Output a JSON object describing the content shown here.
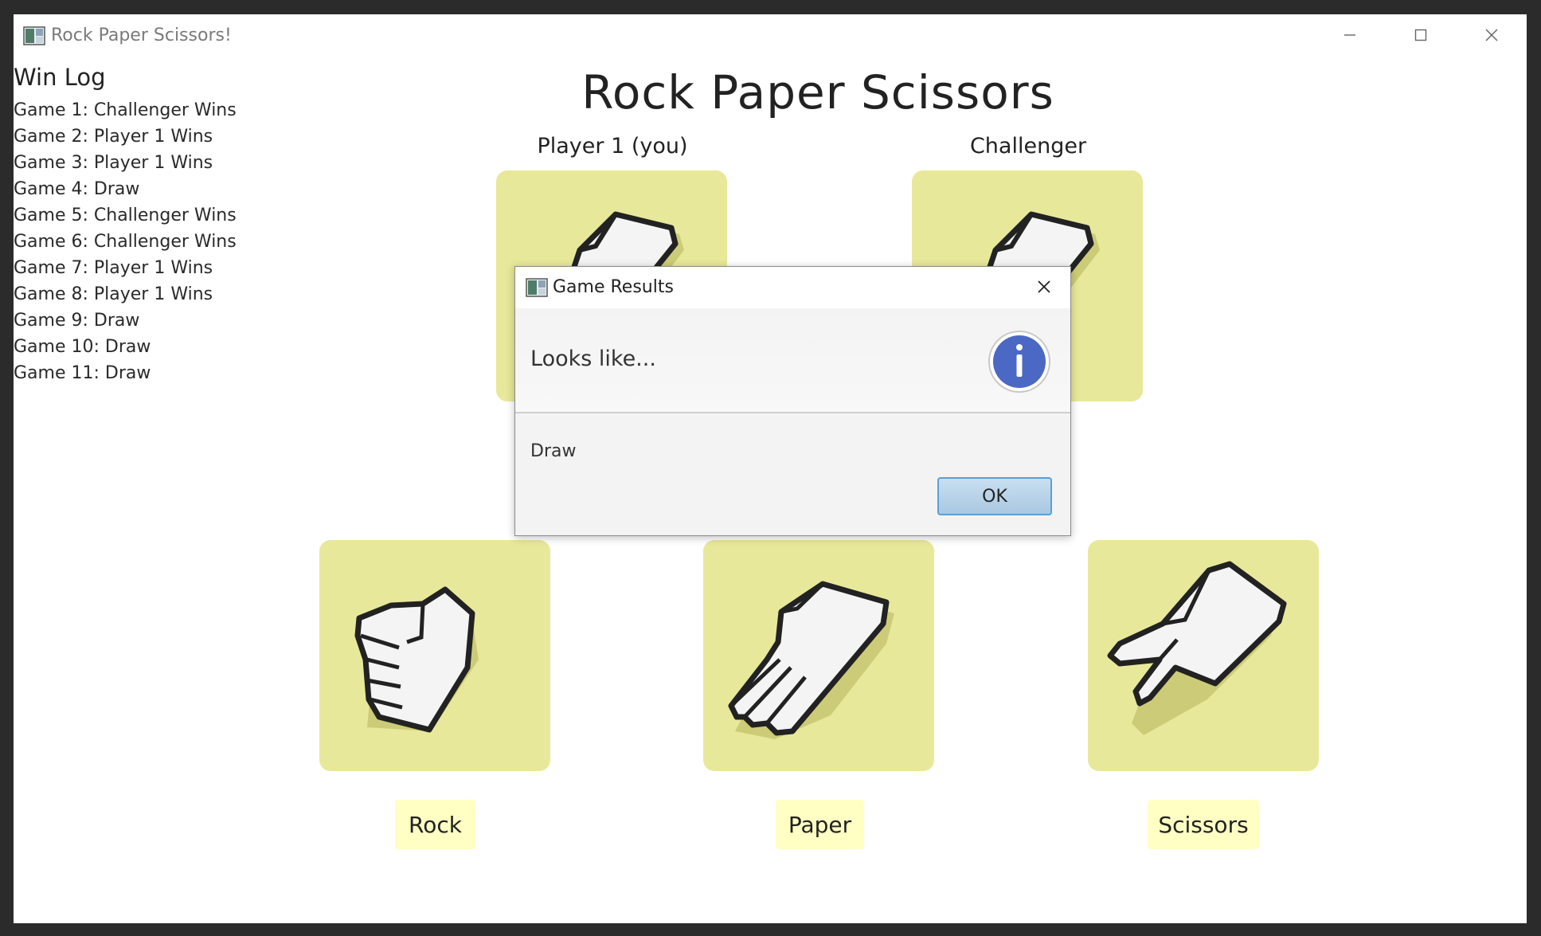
{
  "window": {
    "title": "Rock Paper Scissors!",
    "controls": [
      "minimize-icon",
      "maximize-icon",
      "close-icon"
    ]
  },
  "win_log": {
    "title": "Win Log",
    "items": [
      "Game 1: Challenger Wins",
      "Game 2: Player 1 Wins",
      "Game 3: Player 1 Wins",
      "Game 4: Draw",
      "Game 5: Challenger Wins",
      "Game 6: Challenger Wins",
      "Game 7: Player 1 Wins",
      "Game 8: Player 1 Wins",
      "Game 9: Draw",
      "Game 10: Draw",
      "Game 11: Draw"
    ]
  },
  "game": {
    "title": "Rock Paper Scissors",
    "player1_label": "Player 1 (you)",
    "challenger_label": "Challenger",
    "player1_choice_icon": "paper-hand-icon",
    "challenger_choice_icon": "paper-hand-icon"
  },
  "choices": {
    "rock": {
      "label": "Rock",
      "icon": "rock-hand-icon"
    },
    "paper": {
      "label": "Paper",
      "icon": "paper-hand-icon"
    },
    "scissors": {
      "label": "Scissors",
      "icon": "scissors-hand-icon"
    }
  },
  "dialog": {
    "title": "Game Results",
    "header": "Looks like...",
    "content": "Draw",
    "ok_label": "OK",
    "icon": "info-icon"
  },
  "colors": {
    "tile": "#e8e89a",
    "button": "#ffffc4",
    "info_blue": "#4a68c4",
    "ok_border": "#5aa0d6"
  }
}
